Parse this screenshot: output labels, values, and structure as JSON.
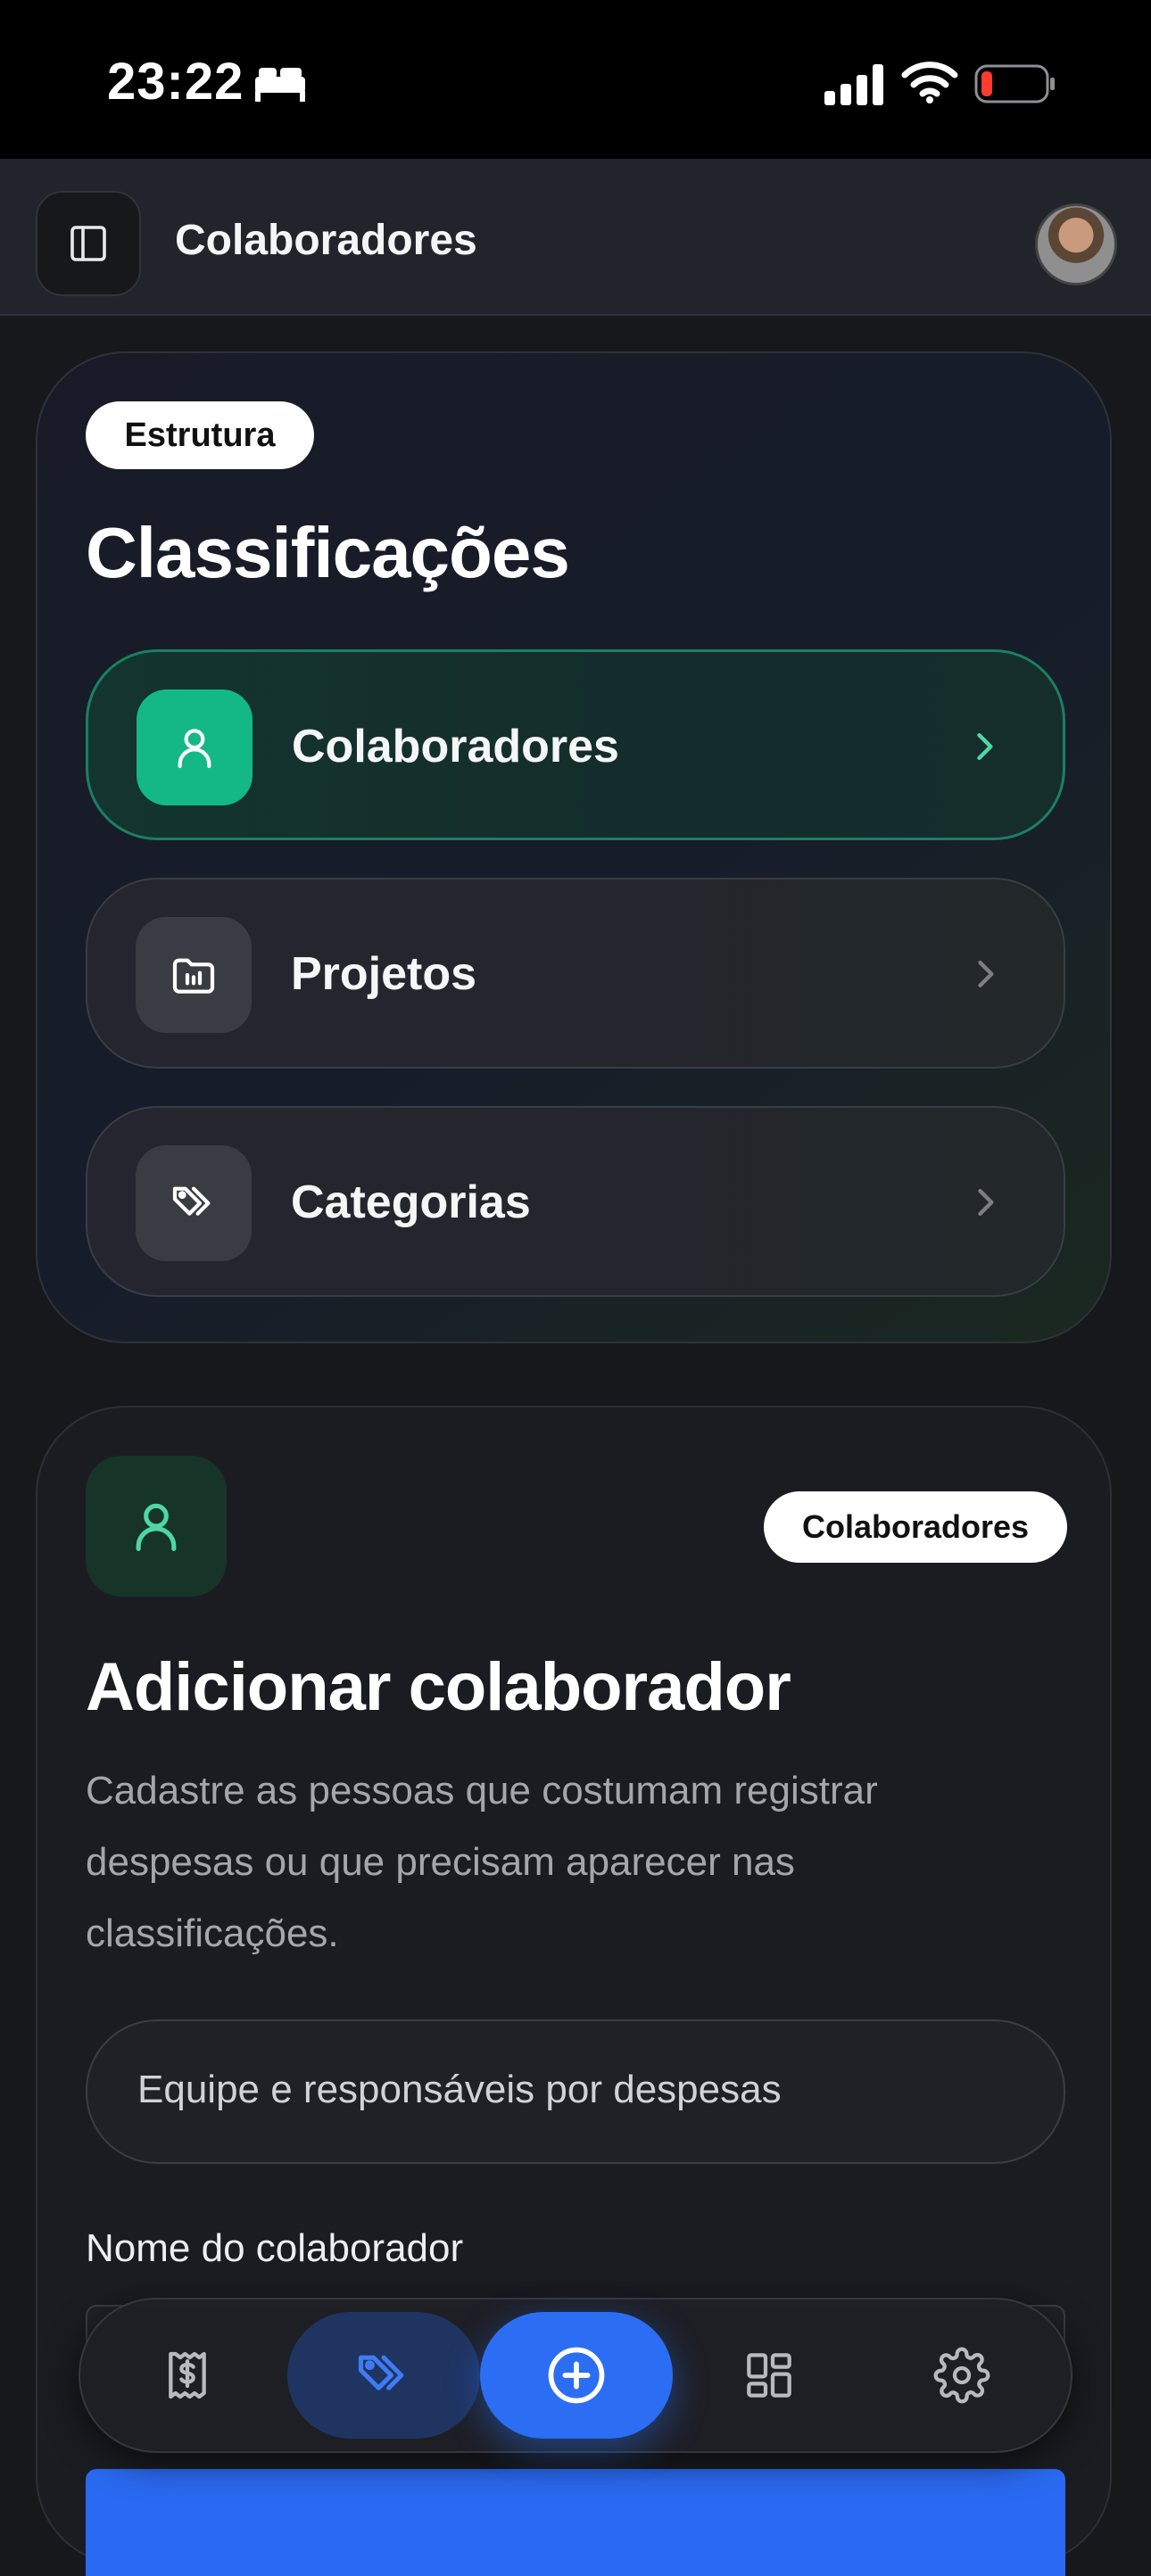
{
  "status_bar": {
    "time": "23:22",
    "icons": [
      "bed-icon",
      "cellular-signal-icon",
      "wifi-icon",
      "battery-low-icon"
    ]
  },
  "header": {
    "title": "Colaboradores",
    "sidebar_toggle_icon": "sidebar-toggle-icon",
    "avatar": "user-avatar"
  },
  "structure_card": {
    "badge": "Estrutura",
    "title": "Classificações",
    "items": [
      {
        "label": "Colaboradores",
        "icon": "user-icon",
        "active": true
      },
      {
        "label": "Projetos",
        "icon": "folder-chart-icon",
        "active": false
      },
      {
        "label": "Categorias",
        "icon": "tags-icon",
        "active": false
      }
    ]
  },
  "add_card": {
    "icon": "user-icon",
    "badge": "Colaboradores",
    "title": "Adicionar colaborador",
    "description": "Cadastre as pessoas que costumam registrar despesas ou que precisam aparecer nas classificações.",
    "info_box": "Equipe e responsáveis por despesas",
    "field_label": "Nome do colaborador",
    "field_value": ""
  },
  "tab_bar": {
    "tabs": [
      {
        "icon": "receipt-dollar-icon",
        "selected": false
      },
      {
        "icon": "tags-icon",
        "selected": true
      },
      {
        "icon": "add-circle-icon",
        "selected": false,
        "primary": true
      },
      {
        "icon": "dashboard-grid-icon",
        "selected": false
      },
      {
        "icon": "settings-gear-icon",
        "selected": false
      }
    ]
  },
  "colors": {
    "accent_green": "#14b886",
    "accent_blue": "#2b6ef3",
    "background": "#17181c"
  }
}
